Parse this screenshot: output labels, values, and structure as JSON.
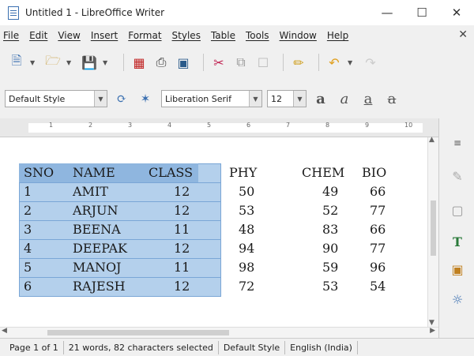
{
  "window": {
    "title": "Untitled 1 - LibreOffice Writer"
  },
  "menu": {
    "items": [
      {
        "name": "file",
        "label": "File"
      },
      {
        "name": "edit",
        "label": "Edit"
      },
      {
        "name": "view",
        "label": "View"
      },
      {
        "name": "insert",
        "label": "Insert"
      },
      {
        "name": "format",
        "label": "Format"
      },
      {
        "name": "styles",
        "label": "Styles"
      },
      {
        "name": "table",
        "label": "Table"
      },
      {
        "name": "tools",
        "label": "Tools"
      },
      {
        "name": "window",
        "label": "Window"
      },
      {
        "name": "help",
        "label": "Help"
      }
    ]
  },
  "format_toolbar": {
    "paragraph_style": "Default Style",
    "font_name": "Liberation Serif",
    "font_size": "12"
  },
  "document": {
    "table": {
      "headers": [
        "SNO",
        "NAME",
        "CLASS",
        "PHY",
        "CHEM",
        "BIO"
      ],
      "rows": [
        [
          "1",
          "AMIT",
          "12",
          "50",
          "49",
          "66"
        ],
        [
          "2",
          "ARJUN",
          "12",
          "53",
          "52",
          "77"
        ],
        [
          "3",
          "BEENA",
          "11",
          "48",
          "83",
          "66"
        ],
        [
          "4",
          "DEEPAK",
          "12",
          "94",
          "90",
          "77"
        ],
        [
          "5",
          "MANOJ",
          "11",
          "98",
          "59",
          "96"
        ],
        [
          "6",
          "RAJESH",
          "12",
          "72",
          "53",
          "54"
        ]
      ]
    }
  },
  "ruler": {
    "numbers": [
      "1",
      "2",
      "3",
      "4",
      "5",
      "6",
      "7",
      "8",
      "9",
      "10"
    ]
  },
  "status": {
    "page": "Page 1 of 1",
    "selection": "21 words, 82 characters selected",
    "page_style": "Default Style",
    "language": "English (India)"
  },
  "colors": {
    "selection": "#b4d0ec",
    "accent": "#3a6fb0"
  }
}
